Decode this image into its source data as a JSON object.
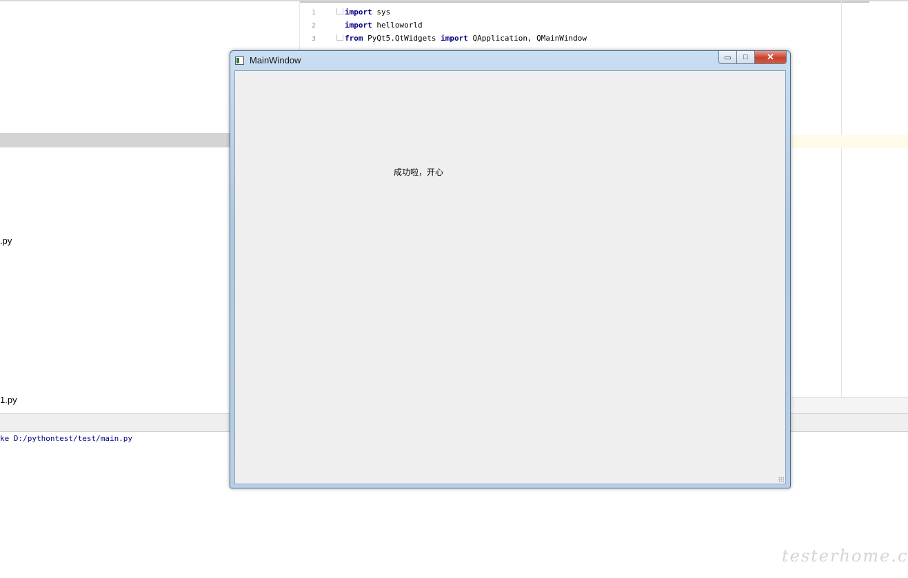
{
  "project": {
    "files": [
      ".py",
      "1.py"
    ]
  },
  "editor": {
    "lines": [
      {
        "num": "1",
        "kw1": "import",
        "rest1": " sys"
      },
      {
        "num": "2",
        "kw1": "import",
        "rest1": " helloworld"
      },
      {
        "num": "3",
        "kw1": "from",
        "rest1": " PyQt5.QtWidgets ",
        "kw2": "import",
        "rest2": " QApplication, QMainWindow"
      }
    ]
  },
  "run_console": {
    "output": "ke D:/pythontest/test/main.py"
  },
  "main_window": {
    "title": "MainWindow",
    "label": "成功啦，开心",
    "controls": {
      "minimize": "▭",
      "maximize": "□",
      "close": "✕"
    }
  },
  "watermark": "testerhome.com"
}
